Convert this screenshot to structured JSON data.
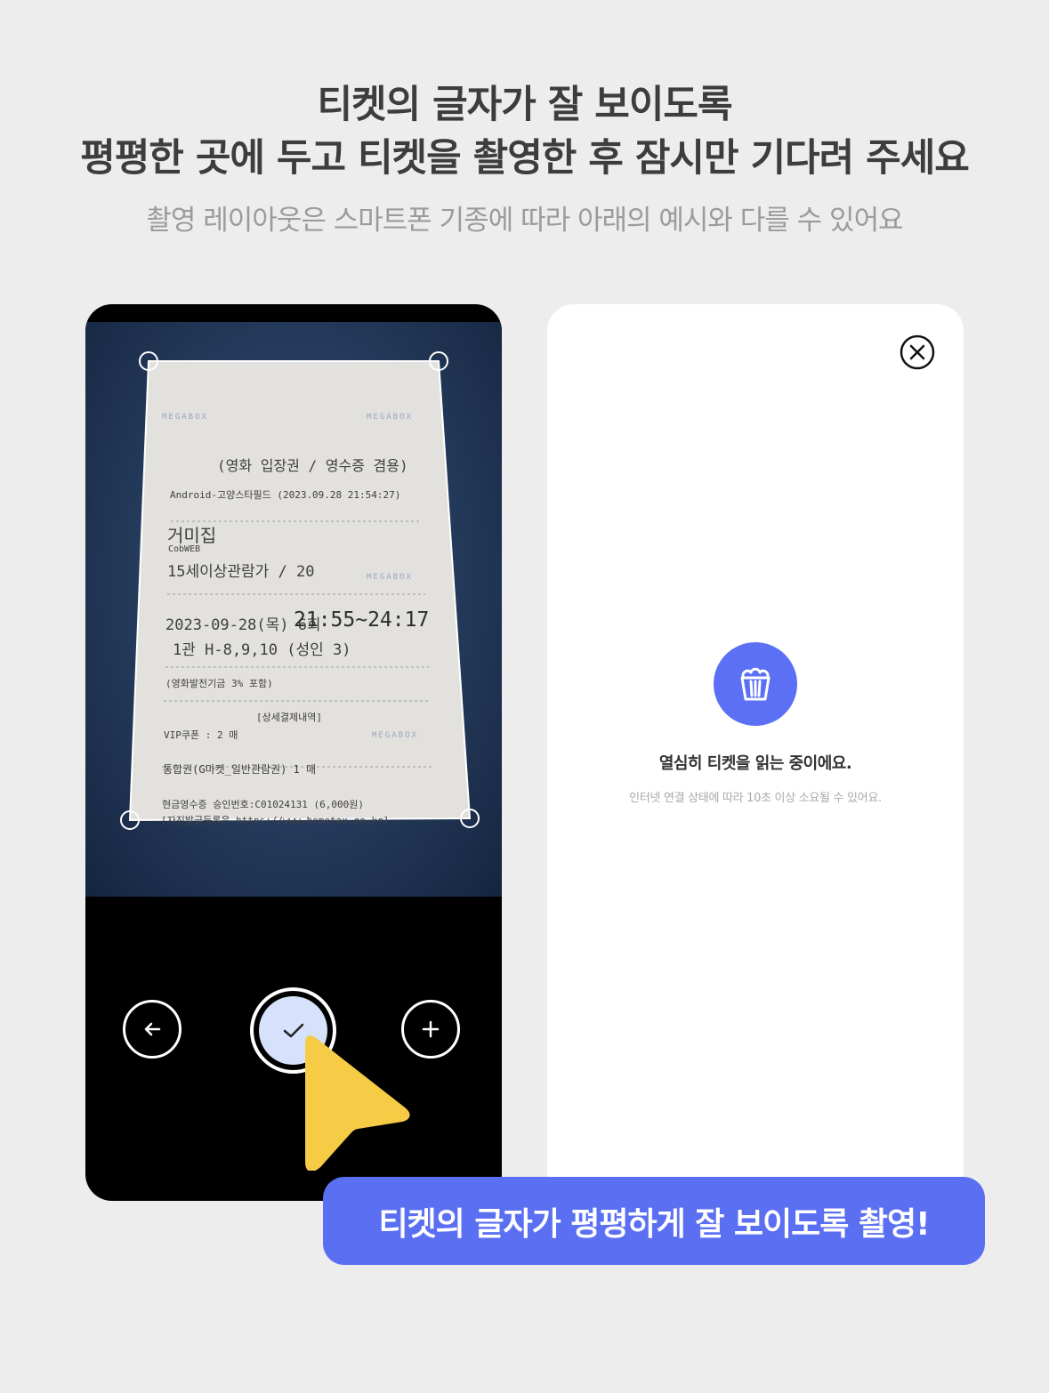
{
  "header": {
    "title_line1": "티켓의 글자가 잘 보이도록",
    "title_line2": "평평한 곳에 두고 티켓을 촬영한 후 잠시만 기다려 주세요",
    "subtitle": "촬영 레이아웃은 스마트폰 기종에 따라 아래의 예시와 다를 수 있어요"
  },
  "receipt": {
    "heading": "(영화 입장권 / 영수증 겸용)",
    "issued": "Android-고양스타필드 (2023.09.28 21:54:27)",
    "movie": "거미집",
    "movie_code": "CobWEB",
    "rating": "15세이상관람가 / 20",
    "showtime_date": "2023-09-28(목) 6회",
    "showtime_time": "21:55~24:17",
    "seats": "1관 H-8,9,10 (성인 3)",
    "fund": "(영화발전기금 3% 포함)",
    "details_header": "[상세결제내역]",
    "vip": "VIP쿠폰 : 2 매",
    "integrated": "통합권(G마켓_일반관람권) 1 매",
    "cash_receipt": "현금영수증 승인번호:C01024131 (6,000원)",
    "self_issue": "[자진발급등록은 https://www.hometax.go.kr]",
    "brand_mark": "MEGABOX"
  },
  "camera": {
    "back_icon": "arrow-left-icon",
    "confirm_icon": "check-icon",
    "add_icon": "plus-icon",
    "accent_color": "#d6e2fb"
  },
  "loading": {
    "close_icon": "close-circle-icon",
    "popcorn_icon": "popcorn-icon",
    "title": "열심히 티켓을 읽는 중이에요.",
    "subtitle": "인터넷 연결 상태에 따라 10초 이상 소요될 수 있어요.",
    "accent_color": "#5b70f5"
  },
  "banner": {
    "text": "티켓의 글자가 평평하게 잘 보이도록 촬영!",
    "color": "#5b6ff2"
  },
  "cursor": {
    "icon": "pointer-cursor-icon",
    "color": "#f6cb45"
  }
}
